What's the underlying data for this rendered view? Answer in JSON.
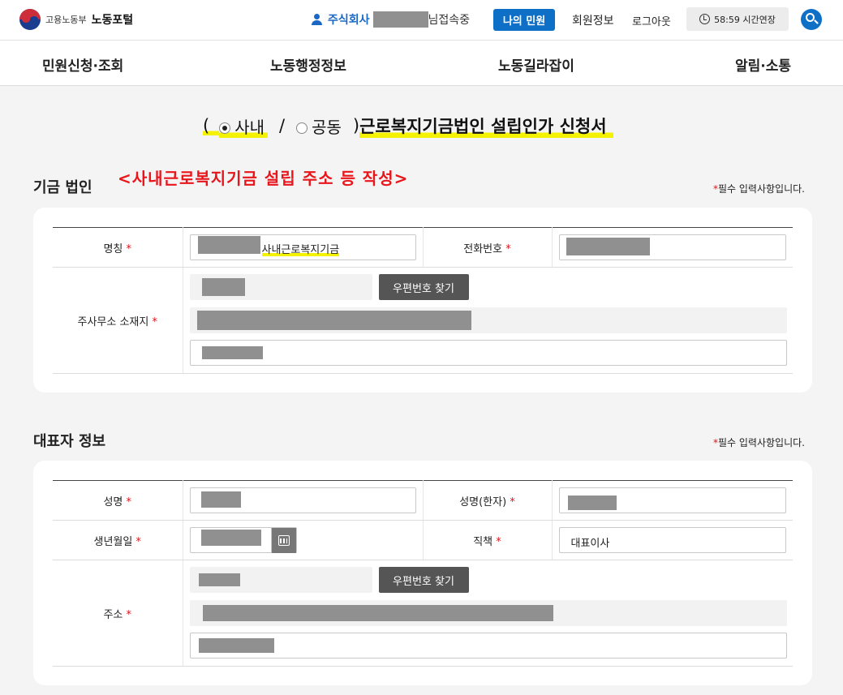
{
  "header": {
    "logo_ministry": "고용노동부",
    "logo_portal": "노동포털",
    "user_company": "주식회사",
    "user_status": "님접속중",
    "my_complaints": "나의 민원",
    "member_info": "회원정보",
    "logout": "로그아웃",
    "session_timer": "58:59 시간연장"
  },
  "nav": {
    "items": [
      "민원신청·조회",
      "노동행정정보",
      "노동길라잡이",
      "알림·소통"
    ]
  },
  "form_title": {
    "open_paren": "(",
    "option_internal": "사내",
    "separator": "/",
    "option_joint": "공동",
    "close_paren": ")",
    "title": "근로복지기금법인 설립인가 신청서"
  },
  "annotation": "<사내근로복지기금 설립 주소 등 작성>",
  "fund_section": {
    "title": "기금 법인",
    "required_note_star": "*",
    "required_note": "필수 입력사항입니다.",
    "name_label": "명칭",
    "name_value_suffix": "사내근로복지기금",
    "phone_label": "전화번호",
    "office_label": "주사무소 소재지",
    "postal_button": "우편번호 찾기"
  },
  "rep_section": {
    "title": "대표자 정보",
    "required_note_star": "*",
    "required_note": "필수 입력사항입니다.",
    "name_label": "성명",
    "name_hanja_label": "성명(한자)",
    "birth_label": "생년월일",
    "position_label": "직책",
    "position_value": "대표이사",
    "address_label": "주소",
    "postal_button": "우편번호 찾기"
  },
  "required_marker": "*",
  "colors": {
    "primary": "#0e6fc7",
    "required": "#d9141b",
    "annotation": "#e8151b",
    "highlight": "#f4f200"
  }
}
